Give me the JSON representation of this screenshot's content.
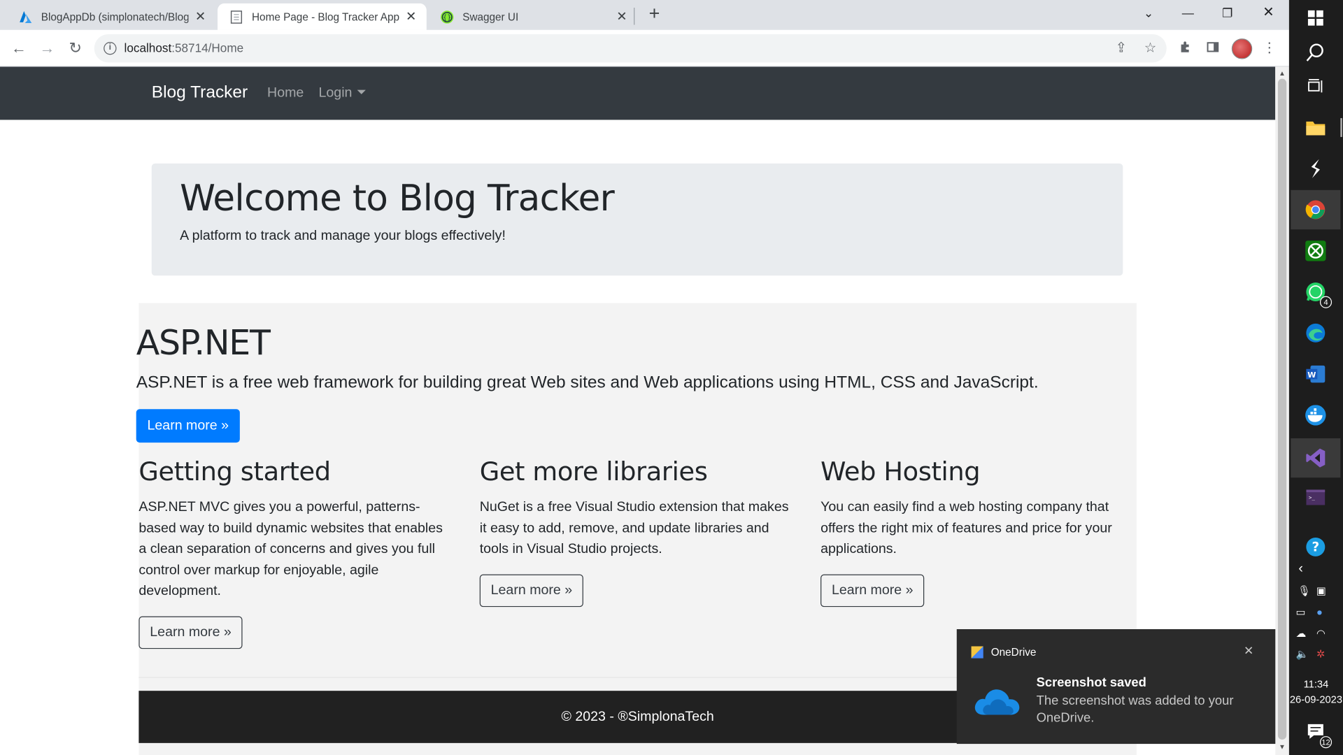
{
  "browser": {
    "tabs": [
      {
        "label": "BlogAppDb (simplonatech/Blog/",
        "icon": "azure-icon"
      },
      {
        "label": "Home Page - Blog Tracker App",
        "icon": "page-icon"
      },
      {
        "label": "Swagger UI",
        "icon": "swagger-icon"
      }
    ],
    "url_host": "localhost",
    "url_path": ":58714/Home"
  },
  "site": {
    "brand": "Blog Tracker",
    "nav": {
      "home": "Home",
      "login": "Login"
    },
    "jumbotron": {
      "title": "Welcome to Blog Tracker",
      "subtitle": "A platform to track and manage your blogs effectively!"
    },
    "hero": {
      "title": "ASP.NET",
      "lead": "ASP.NET is a free web framework for building great Web sites and Web applications using HTML, CSS and JavaScript.",
      "button": "Learn more »"
    },
    "columns": [
      {
        "title": "Getting started",
        "text": "ASP.NET MVC gives you a powerful, patterns-based way to build dynamic websites that enables a clean separation of concerns and gives you full control over markup for enjoyable, agile development.",
        "button": "Learn more »"
      },
      {
        "title": "Get more libraries",
        "text": "NuGet is a free Visual Studio extension that makes it easy to add, remove, and update libraries and tools in Visual Studio projects.",
        "button": "Learn more »"
      },
      {
        "title": "Web Hosting",
        "text": "You can easily find a web hosting company that offers the right mix of features and price for your applications.",
        "button": "Learn more »"
      }
    ],
    "footer": "© 2023 - ®SimplonaTech"
  },
  "toast": {
    "app": "OneDrive",
    "title": "Screenshot saved",
    "body": "The screenshot was added to your OneDrive."
  },
  "taskbar": {
    "time": "11:34",
    "date": "26-09-2023",
    "whatsapp_badge": "4",
    "notifications_count": "12"
  },
  "colors": {
    "navbar": "#343a40",
    "primary": "#007bff",
    "jumbotron": "#e9ecef",
    "footer": "#212121"
  }
}
